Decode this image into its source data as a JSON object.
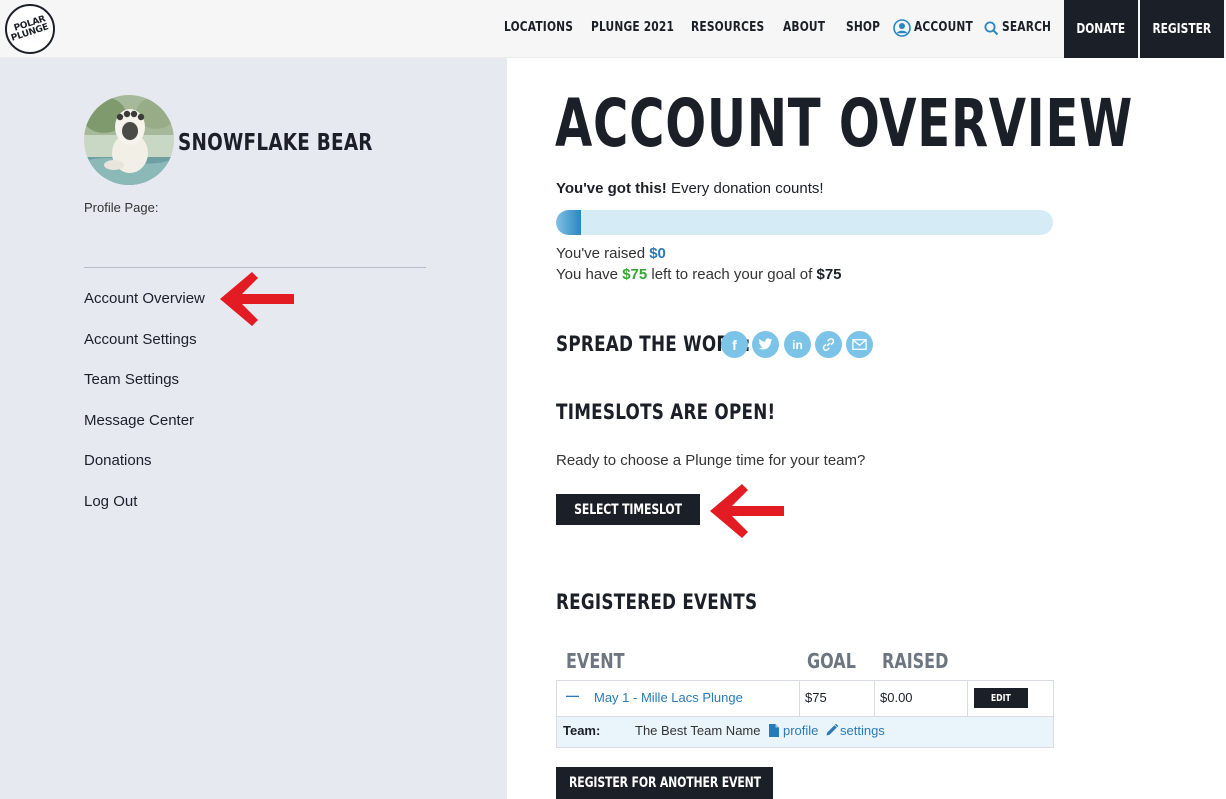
{
  "header": {
    "logo_line1": "POLAR",
    "logo_line2": "PLUNGE",
    "nav": {
      "locations": "LOCATIONS",
      "plunge2021": "PLUNGE 2021",
      "resources": "RESOURCES",
      "about": "ABOUT",
      "shop": "SHOP",
      "account": "ACCOUNT",
      "search": "SEARCH"
    },
    "donate": "DONATE",
    "register": "REGISTER"
  },
  "sidebar": {
    "profile_name": "SNOWFLAKE BEAR",
    "profile_page_label": "Profile Page:",
    "links": {
      "overview": "Account Overview",
      "settings": "Account Settings",
      "team": "Team Settings",
      "messages": "Message Center",
      "donations": "Donations",
      "logout": "Log Out"
    }
  },
  "main": {
    "title": "ACCOUNT OVERVIEW",
    "cheer_bold": "You've got this!",
    "cheer_text": " Every donation counts!",
    "progress_fraction": 0.05,
    "raised_prefix": "You've raised ",
    "raised_amount": "$0",
    "goal_prefix": "You have ",
    "left_amount": "$75",
    "goal_middle": " left to reach your goal of ",
    "goal_amount": "$75",
    "spread_title": "SPREAD THE WORD:",
    "social": {
      "facebook": "f",
      "twitter": "t",
      "linkedin": "in"
    },
    "timeslots_title": "TIMESLOTS ARE OPEN!",
    "ready_text": "Ready to choose a Plunge time for your team?",
    "select_timeslot": "SELECT TIMESLOT",
    "registered_title": "REGISTERED EVENTS",
    "table": {
      "headers": {
        "event": "EVENT",
        "goal": "GOAL",
        "raised": "RAISED"
      },
      "row": {
        "toggle": "—",
        "event": "May 1 - Mille Lacs Plunge",
        "goal": "$75",
        "raised": "$0.00",
        "edit": "EDIT"
      },
      "team": {
        "label": "Team:",
        "name": "The Best Team Name",
        "profile_link": "profile",
        "settings_link": "settings"
      }
    },
    "register_another": "REGISTER FOR ANOTHER EVENT"
  },
  "colors": {
    "dark": "#1b1f27",
    "accent_blue": "#2a7ab8",
    "success_green": "#3aa337",
    "social_blue": "#7cc3e8",
    "annotation_red": "#e31b23"
  }
}
